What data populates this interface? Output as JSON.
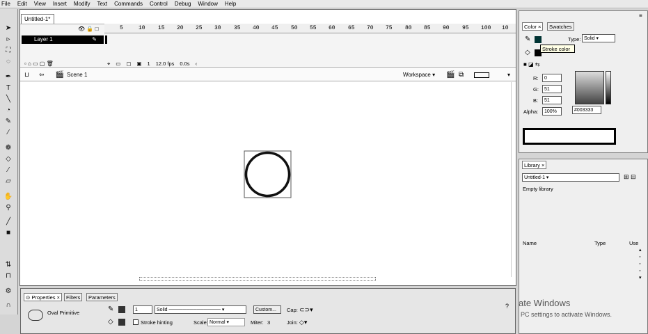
{
  "menubar": {
    "items": [
      "File",
      "Edit",
      "View",
      "Insert",
      "Modify",
      "Text",
      "Commands",
      "Control",
      "Debug",
      "Window",
      "Help"
    ]
  },
  "toolbox": {
    "tools": [
      "selection-icon",
      "subselection-icon",
      "free-transform-icon",
      "lasso-icon",
      "pen-icon",
      "text-icon",
      "line-icon",
      "shape-icon",
      "pencil-icon",
      "brush-icon",
      "deco-icon",
      "paint-bucket-icon",
      "eyedropper-icon",
      "eraser-icon",
      "hand-icon",
      "zoom-icon",
      "stroke-color-icon",
      "fill-color-icon"
    ]
  },
  "document": {
    "tab_label": "Untitled-1*"
  },
  "timeline": {
    "ruler_ticks": [
      "5",
      "10",
      "15",
      "20",
      "25",
      "30",
      "35",
      "40",
      "45",
      "50",
      "55",
      "60",
      "65",
      "70",
      "75",
      "80",
      "85",
      "90",
      "95",
      "100",
      "10"
    ],
    "layer_name": "Layer 1",
    "frame": "1",
    "fps": "12.0 fps",
    "time": "0.0s"
  },
  "scene": {
    "name": "Scene 1",
    "workspace_label": "Workspace ▾"
  },
  "properties": {
    "tabs": [
      "Properties",
      "Filters",
      "Parameters"
    ],
    "object_type": "Oval Primitive",
    "stroke_height": "1",
    "stroke_style": "Solid",
    "custom_label": "Custom...",
    "cap_label": "Cap:",
    "stroke_hinting_label": "Stroke hinting",
    "scale_label": "Scale:",
    "scale_value": "Normal",
    "miter_label": "Miter:",
    "miter_value": "3",
    "join_label": "Join:"
  },
  "color_panel": {
    "tabs": [
      "Color",
      "Swatches"
    ],
    "type_label": "Type:",
    "type_value": "Solid",
    "tooltip": "Stroke color",
    "r_label": "R:",
    "r_value": "0",
    "g_label": "G:",
    "g_value": "51",
    "b_label": "B:",
    "b_value": "51",
    "alpha_label": "Alpha:",
    "alpha_value": "100%",
    "hex_value": "#003333",
    "swatch_color": "#003333"
  },
  "library": {
    "tab": "Library",
    "document": "Untitled-1",
    "empty_label": "Empty library",
    "col_name": "Name",
    "col_type": "Type",
    "col_use": "Use"
  },
  "overlay": {
    "title": "ate Windows",
    "subtitle": "PC settings to activate Windows."
  }
}
